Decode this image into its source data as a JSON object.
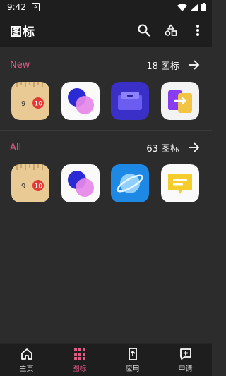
{
  "status_bar": {
    "time": "9:42"
  },
  "app_bar": {
    "title": "图标"
  },
  "sections": [
    {
      "label": "New",
      "count": "18 图标"
    },
    {
      "label": "All",
      "count": "63 图标"
    }
  ],
  "bottom_nav": {
    "items": [
      {
        "label": "主页"
      },
      {
        "label": "图标"
      },
      {
        "label": "应用"
      },
      {
        "label": "申请"
      }
    ]
  },
  "colors": {
    "accent": "#e25a86",
    "background": "#2c2c2c",
    "bar": "#1e1e1e"
  }
}
